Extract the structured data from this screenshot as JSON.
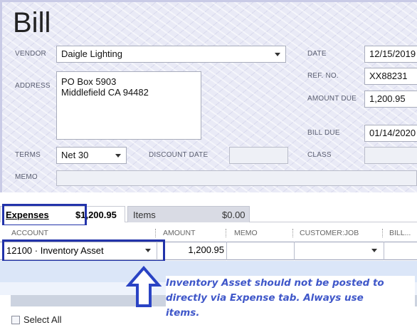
{
  "title": "Bill",
  "vendor": {
    "label": "VENDOR",
    "value": "Daigle Lighting"
  },
  "address": {
    "label": "ADDRESS",
    "line1": "PO Box 5903",
    "line2": "Middlefield CA 94482"
  },
  "terms": {
    "label": "TERMS",
    "value": "Net 30"
  },
  "discount_date": {
    "label": "DISCOUNT DATE",
    "value": ""
  },
  "memo": {
    "label": "MEMO",
    "value": ""
  },
  "date": {
    "label": "DATE",
    "value": "12/15/2019"
  },
  "ref_no": {
    "label": "REF. NO.",
    "value": "XX88231"
  },
  "amount_due": {
    "label": "AMOUNT DUE",
    "value": "1,200.95"
  },
  "bill_due": {
    "label": "BILL DUE",
    "value": "01/14/2020"
  },
  "class": {
    "label": "CLASS",
    "value": ""
  },
  "tabs": [
    {
      "label": "Expenses",
      "amount": "$1,200.95"
    },
    {
      "label": "Items",
      "amount": "$0.00"
    }
  ],
  "columns": [
    "ACCOUNT",
    "AMOUNT",
    "MEMO",
    "CUSTOMER:JOB",
    "BILL..."
  ],
  "expense_row": {
    "account": "12100 · Inventory Asset",
    "amount": "1,200.95",
    "memo": "",
    "customer_job": "",
    "billable": ""
  },
  "annotation": {
    "line1": "Inventory Asset should not be posted to",
    "line2": "directly via Expense tab.  Always use",
    "line3": "items."
  },
  "select_all": {
    "label": "Select All"
  },
  "colors": {
    "annotation": "#3f57c9",
    "highlight_box": "#2233aa",
    "form_bg": "#e9eaf6"
  }
}
